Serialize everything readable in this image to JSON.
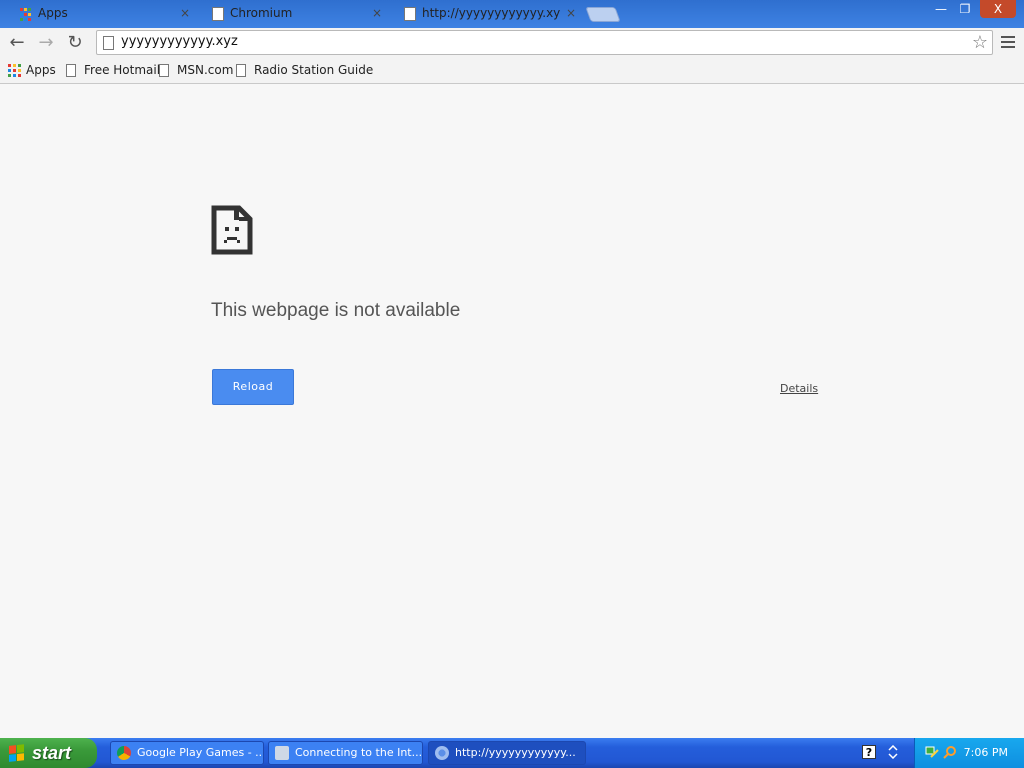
{
  "tabs": [
    {
      "title": "Apps",
      "icon": "apps-grid-icon",
      "close": "×"
    },
    {
      "title": "Chromium",
      "icon": "page-icon",
      "close": "×"
    },
    {
      "title": "http://yyyyyyyyyyyy.xyz/ is",
      "icon": "page-icon",
      "close": "×"
    }
  ],
  "window_controls": {
    "minimize": "—",
    "restore": "❐",
    "close": "X"
  },
  "toolbar": {
    "back": "←",
    "forward": "→",
    "reload": "↻",
    "url": "yyyyyyyyyyyy.xyz",
    "star": "☆"
  },
  "bookmarks": [
    {
      "label": "Apps",
      "icon": "apps-grid-icon"
    },
    {
      "label": "Free Hotmail",
      "icon": "page-icon"
    },
    {
      "label": "MSN.com",
      "icon": "page-icon"
    },
    {
      "label": "Radio Station Guide",
      "icon": "page-icon"
    }
  ],
  "error_page": {
    "headline": "This webpage is not available",
    "reload_label": "Reload",
    "details_label": "Details",
    "icon": "sad-page-icon"
  },
  "taskbar": {
    "start_label": "start",
    "tasks": [
      {
        "label": "Google Play Games - ...",
        "icon": "chrome-icon"
      },
      {
        "label": "Connecting to the Int...",
        "icon": "network-wizard-icon"
      },
      {
        "label": "http://yyyyyyyyyyyy...",
        "icon": "chromium-icon"
      }
    ],
    "help": "?",
    "clock": "7:06 PM"
  },
  "colors": {
    "accent": "#4a8cf0",
    "taskbar": "#245edb",
    "start_green": "#3a9a3a",
    "tray": "#0f8fe0"
  }
}
